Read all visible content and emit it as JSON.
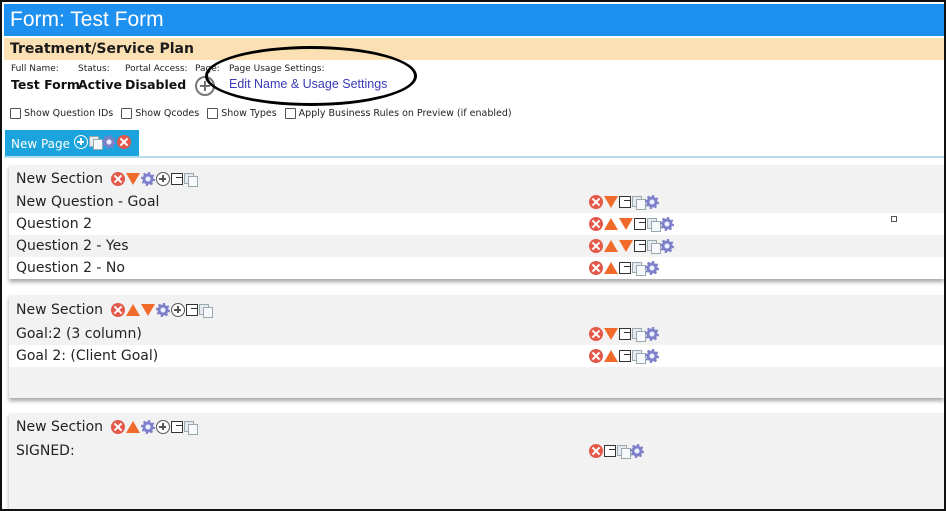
{
  "window": {
    "title": "Form: Test Form"
  },
  "plan": {
    "title": "Treatment/Service Plan"
  },
  "meta": {
    "full_name_label": "Full Name:",
    "full_name": "Test Form",
    "status_label": "Status:",
    "status": "Active",
    "portal_label": "Portal Access:",
    "portal": "Disabled",
    "page_label": "Page:",
    "usage_label": "Page Usage Settings:",
    "usage_link": "Edit Name & Usage Settings"
  },
  "options": {
    "show_question_ids": "Show Question IDs",
    "show_qcodes": "Show Qcodes",
    "show_types": "Show Types",
    "apply_rules": "Apply Business Rules on Preview (if enabled)"
  },
  "page_tab": {
    "label": "New Page"
  },
  "sections": [
    {
      "title": "New Section",
      "header_icons": [
        "delete-icon",
        "move-down-icon",
        "gear-icon",
        "add-icon",
        "export-icon",
        "copy-icon"
      ],
      "questions": [
        {
          "label": "New Question - Goal",
          "icons": [
            "delete-icon",
            "move-down-icon",
            "export-icon",
            "copy-icon",
            "gear-icon"
          ]
        },
        {
          "label": "Question 2",
          "icons": [
            "delete-icon",
            "move-up-icon",
            "move-down-icon",
            "export-icon",
            "copy-icon",
            "gear-icon"
          ]
        },
        {
          "label": "Question 2 - Yes",
          "icons": [
            "delete-icon",
            "move-up-icon",
            "move-down-icon",
            "export-icon",
            "copy-icon",
            "gear-icon"
          ]
        },
        {
          "label": "Question 2 - No",
          "icons": [
            "delete-icon",
            "move-up-icon",
            "export-icon",
            "copy-icon",
            "gear-icon"
          ]
        }
      ]
    },
    {
      "title": "New Section",
      "header_icons": [
        "delete-icon",
        "move-up-icon",
        "move-down-icon",
        "gear-icon",
        "add-icon",
        "export-icon",
        "copy-icon"
      ],
      "questions": [
        {
          "label": "Goal:2 (3 column)",
          "icons": [
            "delete-icon",
            "move-down-icon",
            "export-icon",
            "copy-icon",
            "gear-icon"
          ]
        },
        {
          "label": "Goal 2: (Client Goal)",
          "icons": [
            "delete-icon",
            "move-up-icon",
            "export-icon",
            "copy-icon",
            "gear-icon"
          ]
        }
      ]
    },
    {
      "title": "New Section",
      "header_icons": [
        "delete-icon",
        "move-up-icon",
        "gear-icon",
        "add-icon",
        "export-icon",
        "copy-icon"
      ],
      "questions": [
        {
          "label": "SIGNED:",
          "icons": [
            "delete-icon",
            "export-icon",
            "copy-icon",
            "gear-icon"
          ]
        }
      ]
    }
  ]
}
